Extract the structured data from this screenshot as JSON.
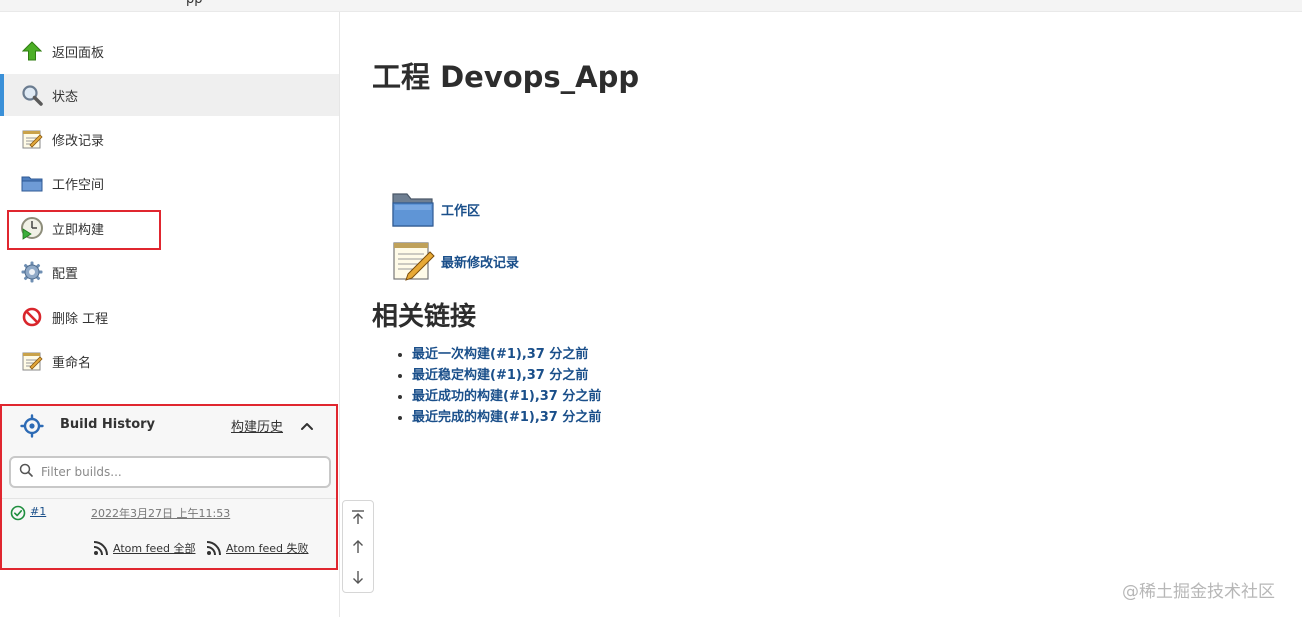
{
  "topbar": {
    "crumb_fragment": "pp"
  },
  "sidebar": {
    "items": [
      {
        "label": "返回面板",
        "icon": "arrow-up-icon"
      },
      {
        "label": "状态",
        "icon": "magnifier-icon"
      },
      {
        "label": "修改记录",
        "icon": "notepad-icon"
      },
      {
        "label": "工作空间",
        "icon": "folder-icon"
      },
      {
        "label": "立即构建",
        "icon": "clock-play-icon"
      },
      {
        "label": "配置",
        "icon": "gear-icon"
      },
      {
        "label": "删除 工程",
        "icon": "no-entry-icon"
      },
      {
        "label": "重命名",
        "icon": "notepad-icon"
      }
    ],
    "active_item": "状态"
  },
  "build_history": {
    "title": "Build History",
    "trend_link": "构建历史",
    "filter_placeholder": "Filter builds...",
    "builds": [
      {
        "number": "#1",
        "date": "2022年3月27日 上午11:53",
        "status": "success"
      }
    ],
    "feeds": {
      "all": "Atom feed 全部",
      "failed": "Atom feed 失败"
    }
  },
  "main": {
    "title": "工程 Devops_App",
    "links": [
      {
        "label": "工作区",
        "icon": "folder-icon"
      },
      {
        "label": "最新修改记录",
        "icon": "notepad-icon"
      }
    ],
    "permalinks_title": "相关链接",
    "permalinks": [
      {
        "link": "最近一次构建(#1),37 分之前"
      },
      {
        "link": "最近稳定构建(#1),37 分之前"
      },
      {
        "link": "最近成功的构建(#1),37 分之前"
      },
      {
        "link": "最近完成的构建(#1),37 分之前"
      }
    ]
  },
  "watermark": "@稀土掘金技术社区",
  "colors": {
    "link": "#1a4f8a",
    "active_bar": "#3a90d8",
    "highlight": "#e0262f",
    "success": "#1e8e3e"
  }
}
